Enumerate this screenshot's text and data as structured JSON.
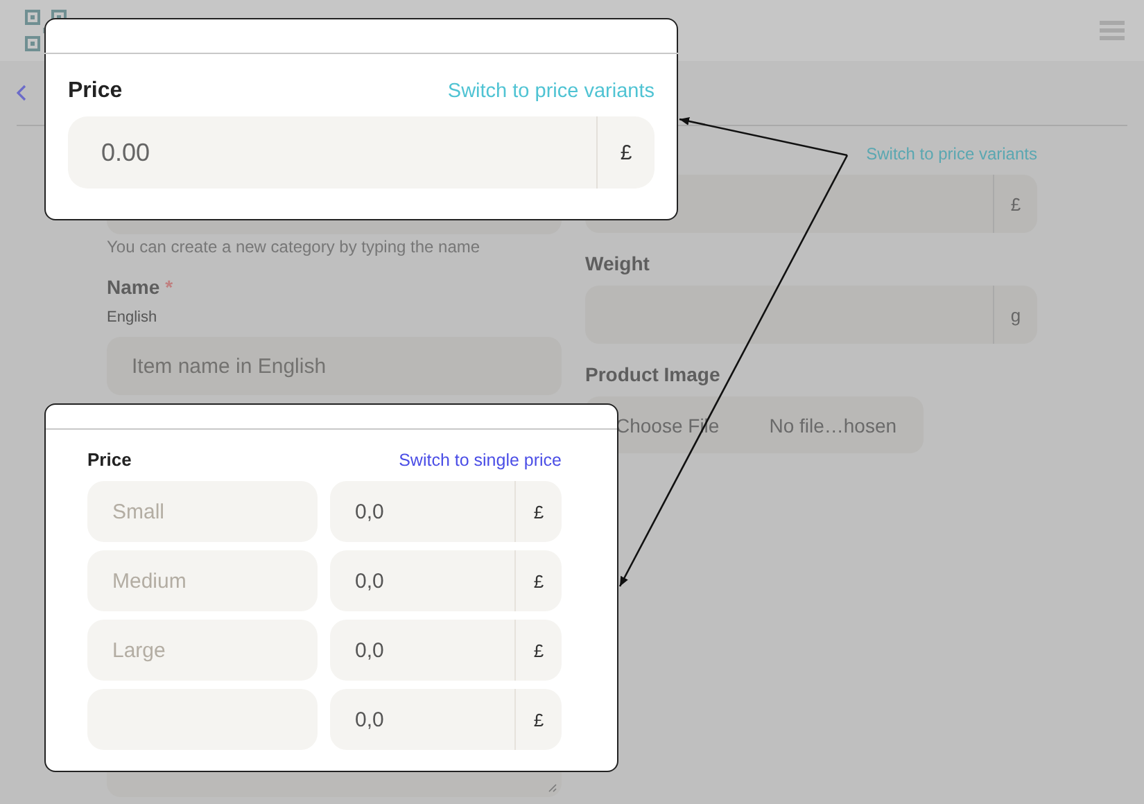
{
  "page": {
    "category_hint": "You can create a new category by typing the name",
    "name_label": "Name",
    "required_mark": "*",
    "language": "English",
    "name_placeholder": "Item name in English",
    "price_link": "Switch to price variants",
    "price_currency": "£",
    "weight_label": "Weight",
    "weight_unit": "g",
    "image_label": "Product Image",
    "file_button": "Choose File",
    "file_status": "No file…hosen"
  },
  "callouts": [
    {
      "kind": "single",
      "title": "Price",
      "link": "Switch to price variants",
      "value": "0.00",
      "currency": "£"
    },
    {
      "kind": "variants",
      "title": "Price",
      "link": "Switch to single price",
      "variants": [
        {
          "placeholder": "Small",
          "value": "0,0",
          "currency": "£"
        },
        {
          "placeholder": "Medium",
          "value": "0,0",
          "currency": "£"
        },
        {
          "placeholder": "Large",
          "value": "0,0",
          "currency": "£"
        },
        {
          "value": "0,0",
          "currency": "£"
        }
      ]
    }
  ]
}
